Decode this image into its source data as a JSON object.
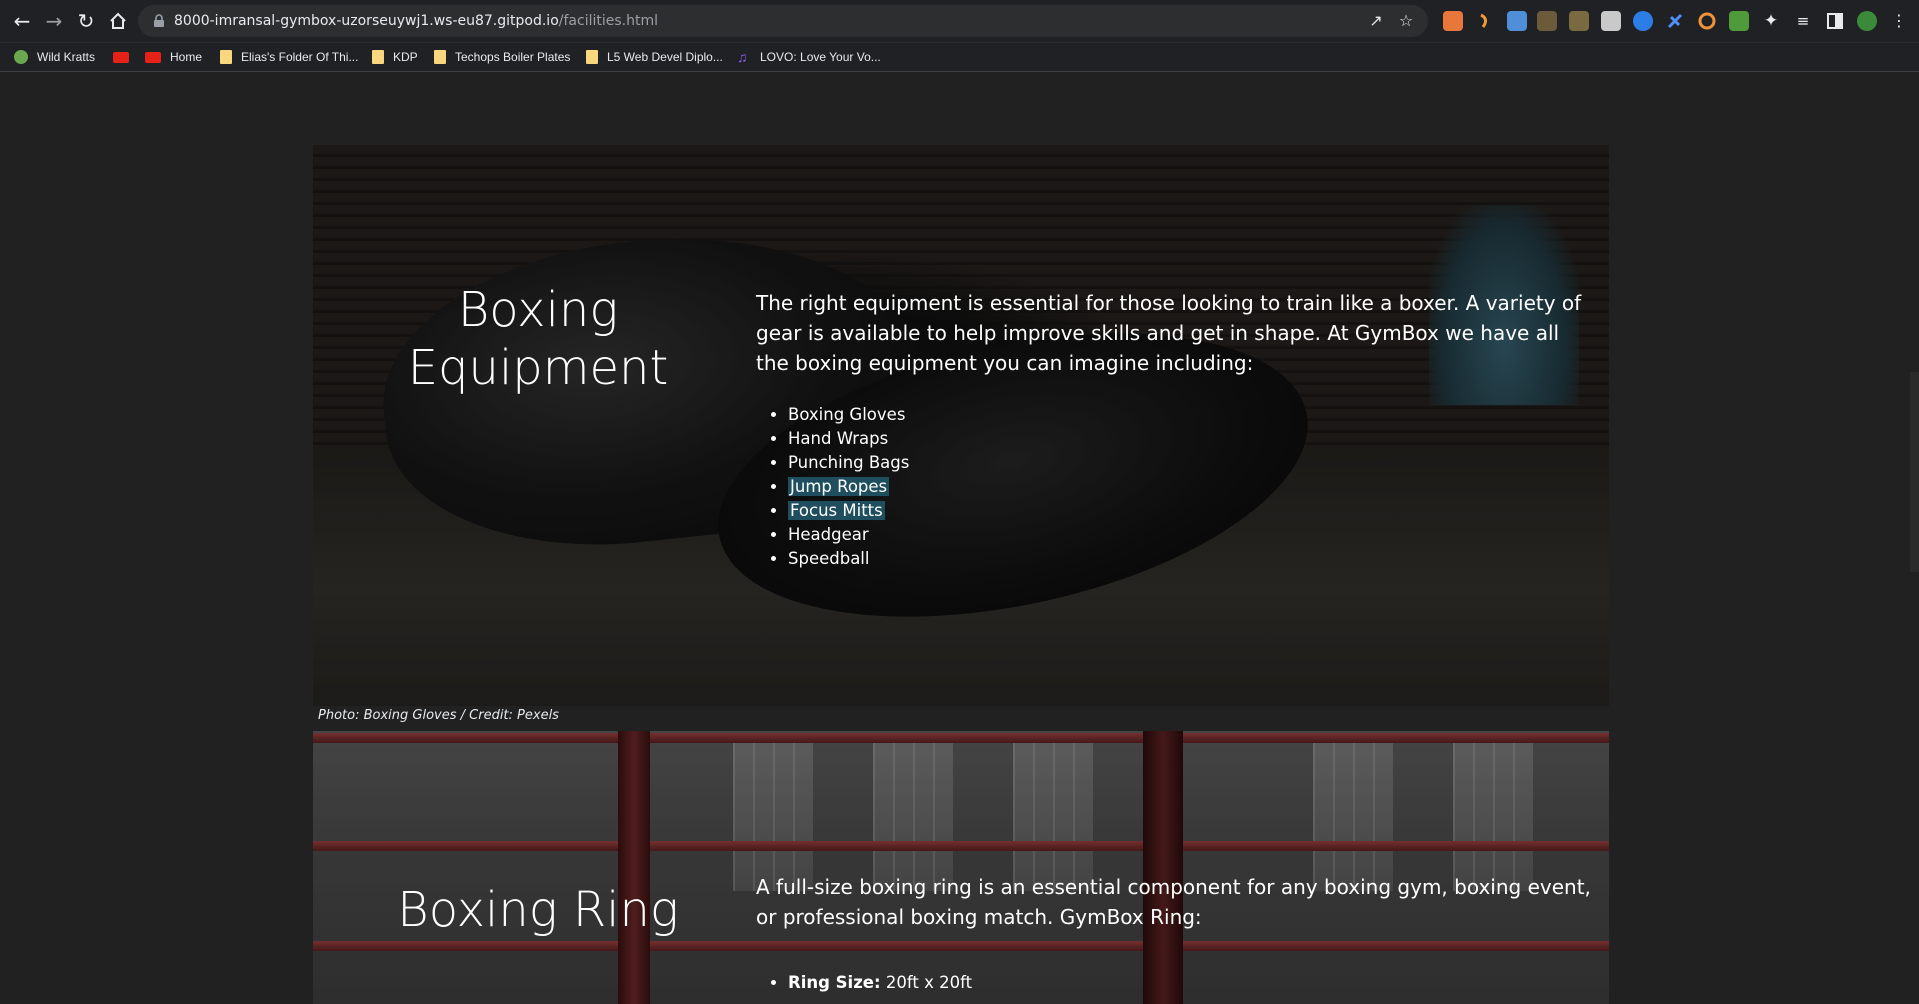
{
  "browser": {
    "url_host": "8000-imransal-gymbox-uzorseuywj1.ws-eu87.gitpod.io",
    "url_path": "/facilities.html",
    "bookmarks": [
      {
        "label": "Wild Kratts"
      },
      {
        "label": ""
      },
      {
        "label": "Home"
      },
      {
        "label": "Elias's Folder Of Thi..."
      },
      {
        "label": "KDP"
      },
      {
        "label": "Techops Boiler Plates"
      },
      {
        "label": "L5 Web Devel Diplo..."
      },
      {
        "label": "LOVO: Love Your Vo..."
      }
    ]
  },
  "sections": [
    {
      "heading": "Boxing Equipment",
      "paragraph": "The right equipment is essential for those looking to train like a boxer. A variety of gear is available to help improve skills and get in shape. At GymBox we have all the boxing equipment you can imagine including:",
      "items": [
        "Boxing Gloves",
        "Hand Wraps",
        "Punching Bags",
        "Jump Ropes",
        "Focus Mitts",
        "Headgear",
        "Speedball"
      ],
      "caption": "Photo: Boxing Gloves / Credit: Pexels"
    },
    {
      "heading": "Boxing Ring",
      "paragraph": "A full-size boxing ring is an essential component for any boxing gym, boxing event, or professional boxing match. GymBox Ring:",
      "item_label": "Ring Size:",
      "item_value": "20ft x 20ft"
    }
  ]
}
